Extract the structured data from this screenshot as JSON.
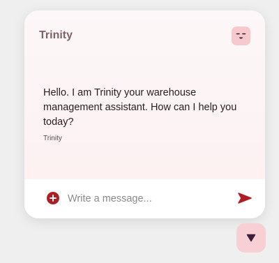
{
  "header": {
    "title": "Trinity",
    "avatar_icon": "smiling-face-icon"
  },
  "message": {
    "text": "Hello. I am Trinity your warehouse management assistant. How can I help you today?",
    "author": "Trinity"
  },
  "composer": {
    "placeholder": "Write a message...",
    "add_icon": "plus-circle-icon",
    "send_icon": "send-icon"
  },
  "toggle": {
    "icon": "caret-down-icon"
  },
  "colors": {
    "accent": "#b01e24",
    "title": "#7b6368",
    "avatar_bg": "#f7c9cf",
    "toggle_bg": "#f7cfd4",
    "toggle_icon": "#3a1f3a"
  }
}
